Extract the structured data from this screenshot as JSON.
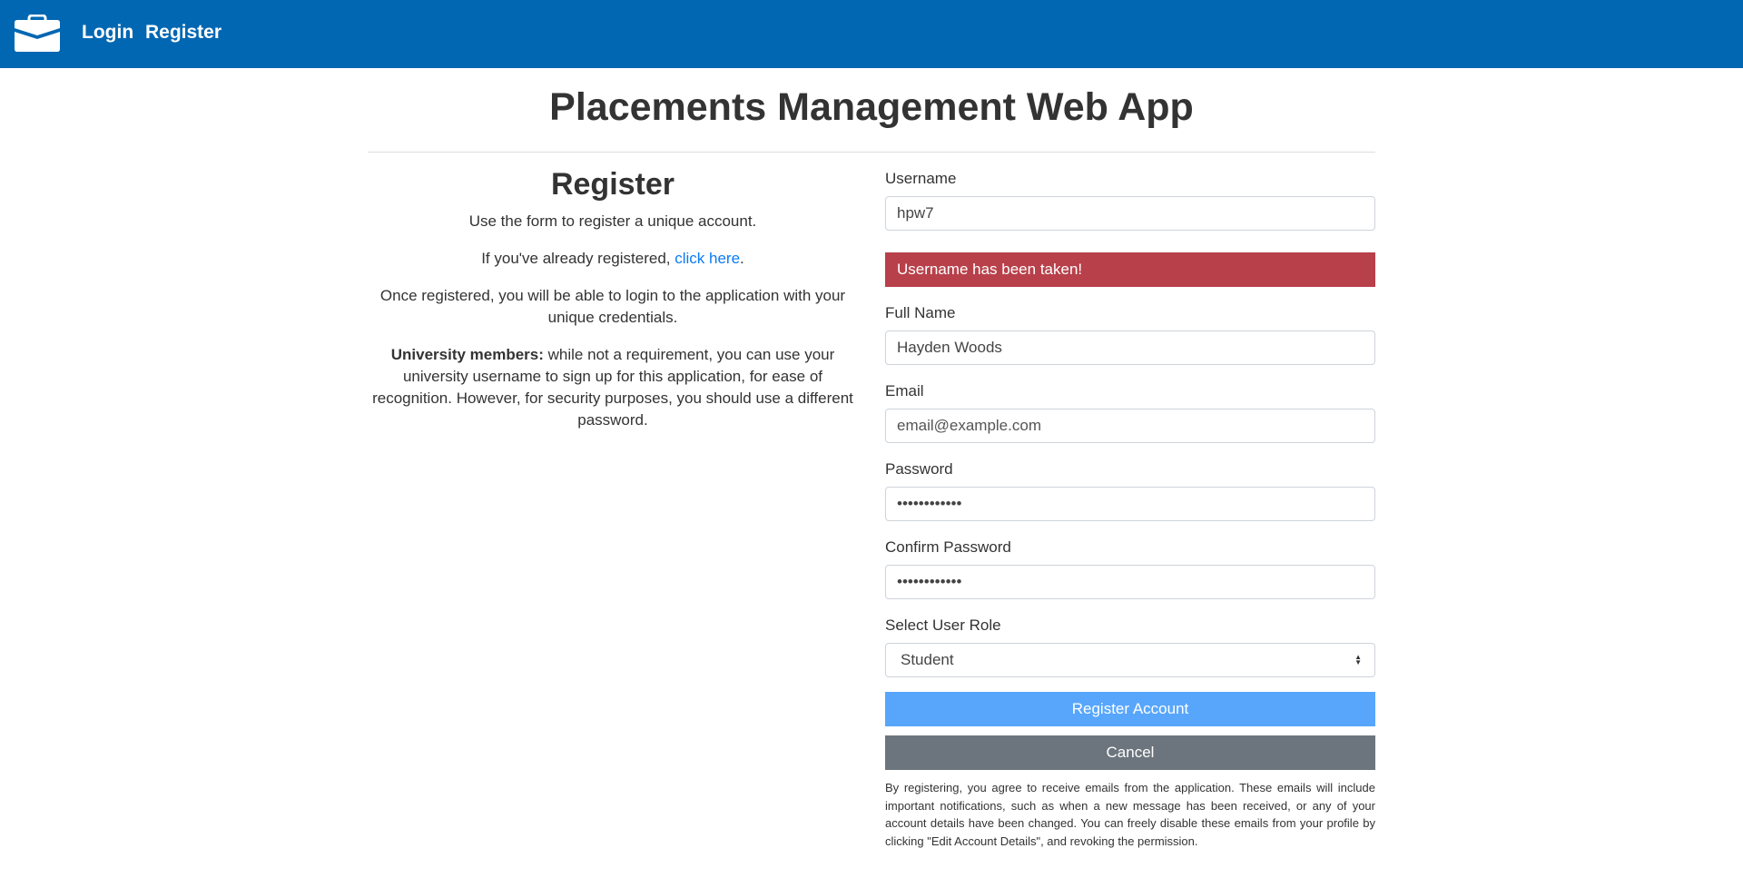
{
  "nav": {
    "logo_icon": "briefcase-icon",
    "login": "Login",
    "register": "Register",
    "bg_color": "#0267b2"
  },
  "title": "Placements Management Web App",
  "info": {
    "heading": "Register",
    "p1": "Use the form to register a unique account.",
    "p2_before": "If you've already registered, ",
    "p2_link": "click here",
    "p2_after": ".",
    "p3": "Once registered, you will be able to login to the application with your unique credentials.",
    "p4_bold": "University members:",
    "p4": " while not a requirement, you can use your university username to sign up for this application, for ease of recognition. However, for security purposes, you should use a different password."
  },
  "form": {
    "username_label": "Username",
    "username_value": "hpw7",
    "error": "Username has been taken!",
    "fullname_label": "Full Name",
    "fullname_value": "Hayden Woods",
    "email_label": "Email",
    "email_placeholder": "email@example.com",
    "password_label": "Password",
    "password_value": "••••••••••••",
    "confirm_label": "Confirm Password",
    "confirm_value": "••••••••••••",
    "role_label": "Select User Role",
    "role_value": "Student",
    "register_button": "Register Account",
    "cancel_button": "Cancel",
    "fine_print": "By registering, you agree to receive emails from the application. These emails will include important notifications, such as when a new message has been received, or any of your account details have been changed. You can freely disable these emails from your profile by clicking \"Edit Account Details\", and revoking the permission."
  },
  "colors": {
    "error": "#b8404a",
    "primary": "#58a6fc",
    "secondary": "#6c757d",
    "link": "#0a7cf5"
  }
}
